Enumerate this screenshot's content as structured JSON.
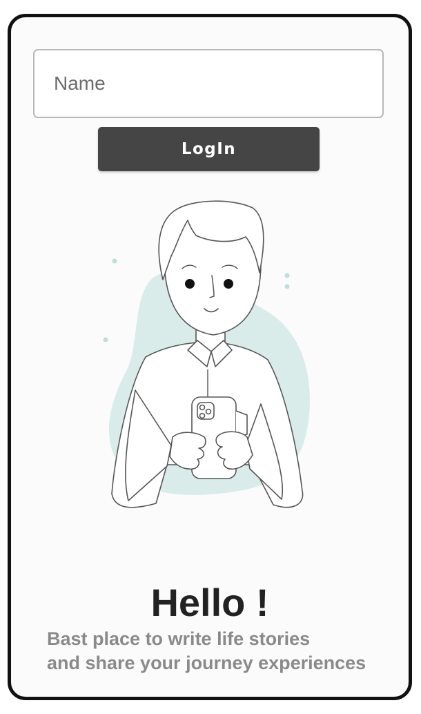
{
  "login": {
    "name_placeholder": "Name",
    "name_value": "",
    "login_label": "LogIn"
  },
  "greeting": {
    "title": "Hello  !",
    "subtitle_line1": "Bast place to write life stories",
    "subtitle_line2": "and share your journey experiences"
  },
  "illustration": {
    "subject": "person-holding-phone-illustration"
  },
  "colors": {
    "frame_border": "#111111",
    "button_bg": "#454545",
    "button_text": "#ffffff",
    "title_text": "#222222",
    "subtitle_text": "#8a8a8a",
    "blob": "#d9ecea"
  }
}
